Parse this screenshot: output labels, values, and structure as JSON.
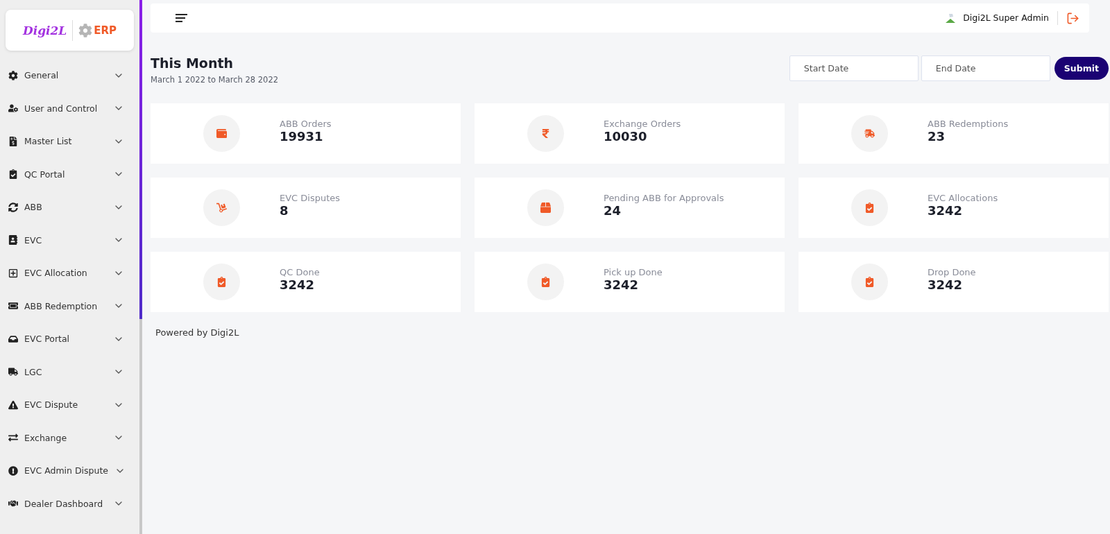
{
  "logo": {
    "brand": "Digi2L",
    "product": "ERP"
  },
  "sidebar": {
    "items": [
      {
        "label": "General",
        "expanded": false
      },
      {
        "label": "User and Control",
        "expanded": false
      },
      {
        "label": "Master List",
        "expanded": false
      },
      {
        "label": "QC Portal",
        "expanded": false
      },
      {
        "label": "ABB",
        "expanded": false
      },
      {
        "label": "EVC",
        "expanded": false
      },
      {
        "label": "EVC Allocation",
        "expanded": false
      },
      {
        "label": "ABB Redemption",
        "expanded": false
      },
      {
        "label": "EVC Portal",
        "expanded": false
      },
      {
        "label": "LGC",
        "expanded": false
      },
      {
        "label": "EVC Dispute",
        "expanded": false
      },
      {
        "label": "Exchange",
        "expanded": false
      },
      {
        "label": "EVC Admin Dispute",
        "expanded": false
      },
      {
        "label": "Dealer Dashboard",
        "expanded": false
      }
    ]
  },
  "header": {
    "user": "Digi2L Super Admin"
  },
  "period": {
    "title": "This Month",
    "range": "March 1 2022 to March 28 2022"
  },
  "filter": {
    "start_placeholder": "Start Date",
    "end_placeholder": "End Date",
    "submit": "Submit"
  },
  "stats": [
    {
      "label": "ABB Orders",
      "value": "19931"
    },
    {
      "label": "Exchange Orders",
      "value": "10030"
    },
    {
      "label": "ABB Redemptions",
      "value": "23"
    },
    {
      "label": "EVC Disputes",
      "value": "8"
    },
    {
      "label": "Pending ABB for Approvals",
      "value": "24"
    },
    {
      "label": "EVC Allocations",
      "value": "3242"
    },
    {
      "label": "QC Done",
      "value": "3242"
    },
    {
      "label": "Pick up Done",
      "value": "3242"
    },
    {
      "label": "Drop Done",
      "value": "3242"
    }
  ],
  "footer": "Powered by Digi2L"
}
